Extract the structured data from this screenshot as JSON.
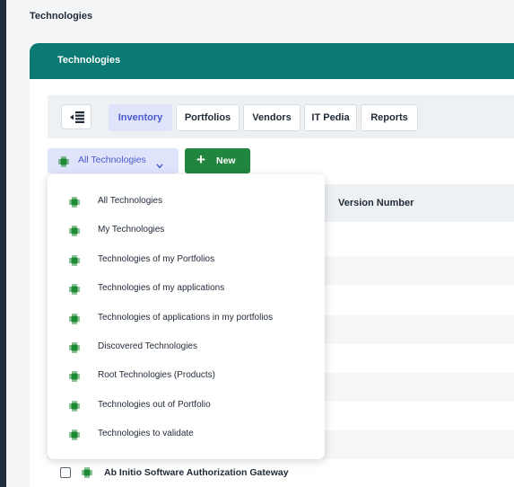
{
  "page": {
    "title": "Technologies"
  },
  "panel": {
    "title": "Technologies"
  },
  "tabs": [
    {
      "label": "Inventory",
      "active": true
    },
    {
      "label": "Portfolios",
      "active": false
    },
    {
      "label": "Vendors",
      "active": false
    },
    {
      "label": "IT Pedia",
      "active": false
    },
    {
      "label": "Reports",
      "active": false
    }
  ],
  "toolbar": {
    "filter_label": "All Technologies",
    "filter_icon": "chip-icon",
    "new_label": "New",
    "new_icon": "plus-icon"
  },
  "table": {
    "columns": [
      "Version Number"
    ],
    "rows": [
      {
        "name": "Ab Initio Software Authorization Gateway"
      }
    ]
  },
  "dropdown": {
    "items": [
      "All Technologies",
      "My Technologies",
      "Technologies of my Portfolios",
      "Technologies of my applications",
      "Technologies of applications in my portfolios",
      "Discovered Technologies",
      "Root Technologies (Products)",
      "Technologies out of Portfolio",
      "Technologies to validate"
    ]
  },
  "colors": {
    "header_teal": "#0a7a73",
    "accent_blue": "#4a5bd1",
    "accent_blue_bg": "#dfe4fb",
    "new_green": "#20853d",
    "chip_green": "#1e8a35"
  }
}
